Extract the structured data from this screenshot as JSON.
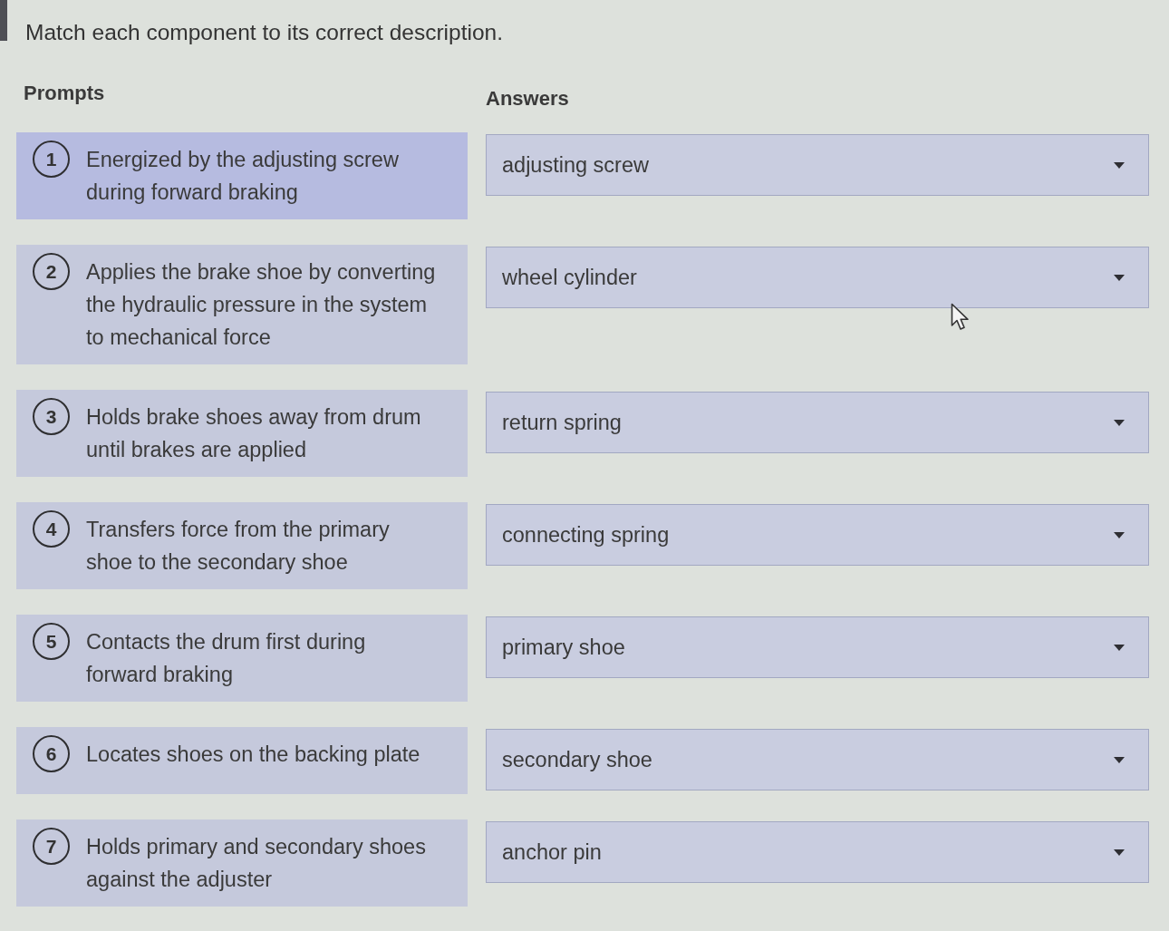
{
  "instruction": "Match each component to its correct description.",
  "headers": {
    "prompts": "Prompts",
    "answers": "Answers"
  },
  "rows": [
    {
      "number": "1",
      "prompt": "Energized by the adjusting screw during forward braking",
      "selected": true,
      "answer": "adjusting screw"
    },
    {
      "number": "2",
      "prompt": "Applies the brake shoe by converting the hydraulic pressure in the system to mechanical force",
      "selected": false,
      "answer": "wheel cylinder"
    },
    {
      "number": "3",
      "prompt": "Holds brake shoes away from drum until brakes are applied",
      "selected": false,
      "answer": "return spring"
    },
    {
      "number": "4",
      "prompt": "Transfers force from the primary shoe to the secondary shoe",
      "selected": false,
      "answer": "connecting spring"
    },
    {
      "number": "5",
      "prompt": "Contacts the drum first during forward braking",
      "selected": false,
      "answer": "primary shoe"
    },
    {
      "number": "6",
      "prompt": "Locates shoes on the backing plate",
      "selected": false,
      "answer": "secondary shoe"
    },
    {
      "number": "7",
      "prompt": "Holds primary and secondary shoes against the adjuster",
      "selected": false,
      "answer": "anchor pin"
    }
  ]
}
